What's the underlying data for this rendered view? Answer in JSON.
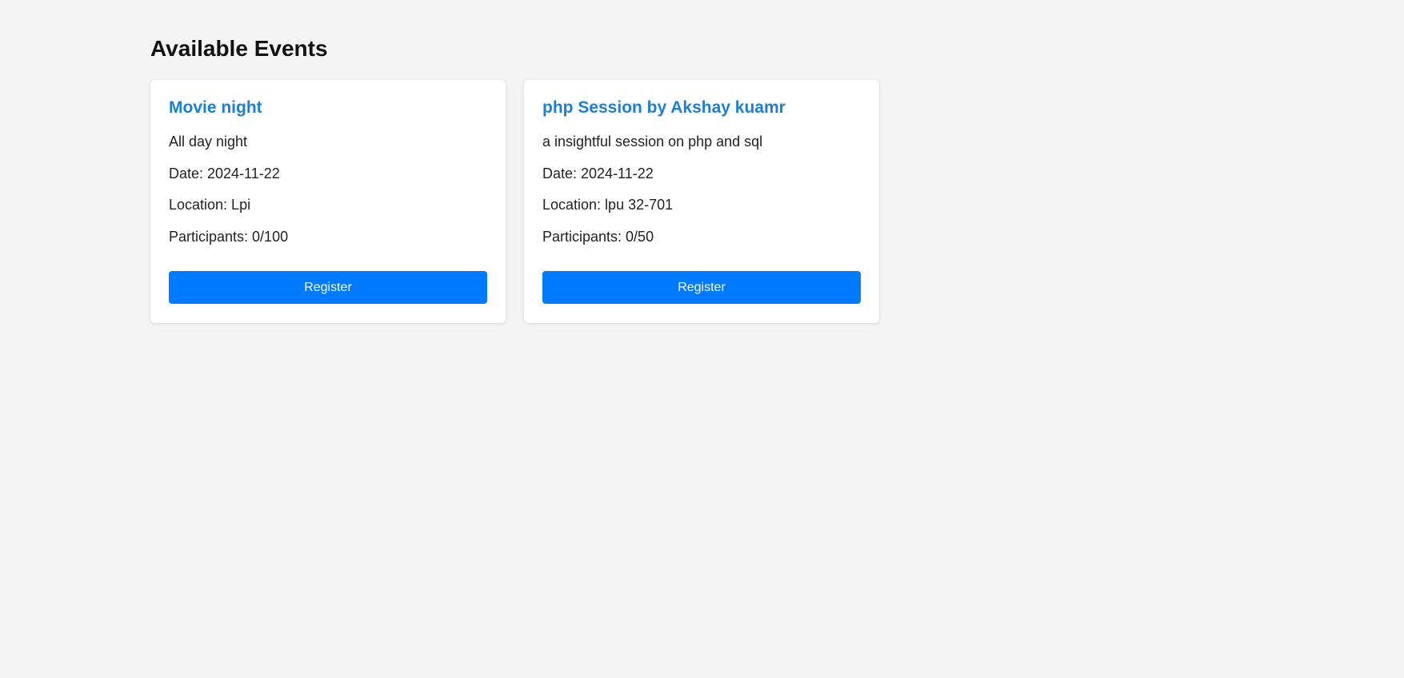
{
  "page": {
    "title": "Available Events"
  },
  "events": [
    {
      "title": "Movie night",
      "description": "All day night",
      "date": "Date: 2024-11-22",
      "location": "Location: Lpi",
      "participants": "Participants: 0/100",
      "button_label": "Register"
    },
    {
      "title": "php Session by Akshay kuamr",
      "description": "a insightful session on php and sql",
      "date": "Date: 2024-11-22",
      "location": "Location: lpu 32-701",
      "participants": "Participants: 0/50",
      "button_label": "Register"
    }
  ],
  "colors": {
    "background": "#f4f4f4",
    "card": "#ffffff",
    "accent_title": "#1a7fd8",
    "button": "#007bff"
  }
}
